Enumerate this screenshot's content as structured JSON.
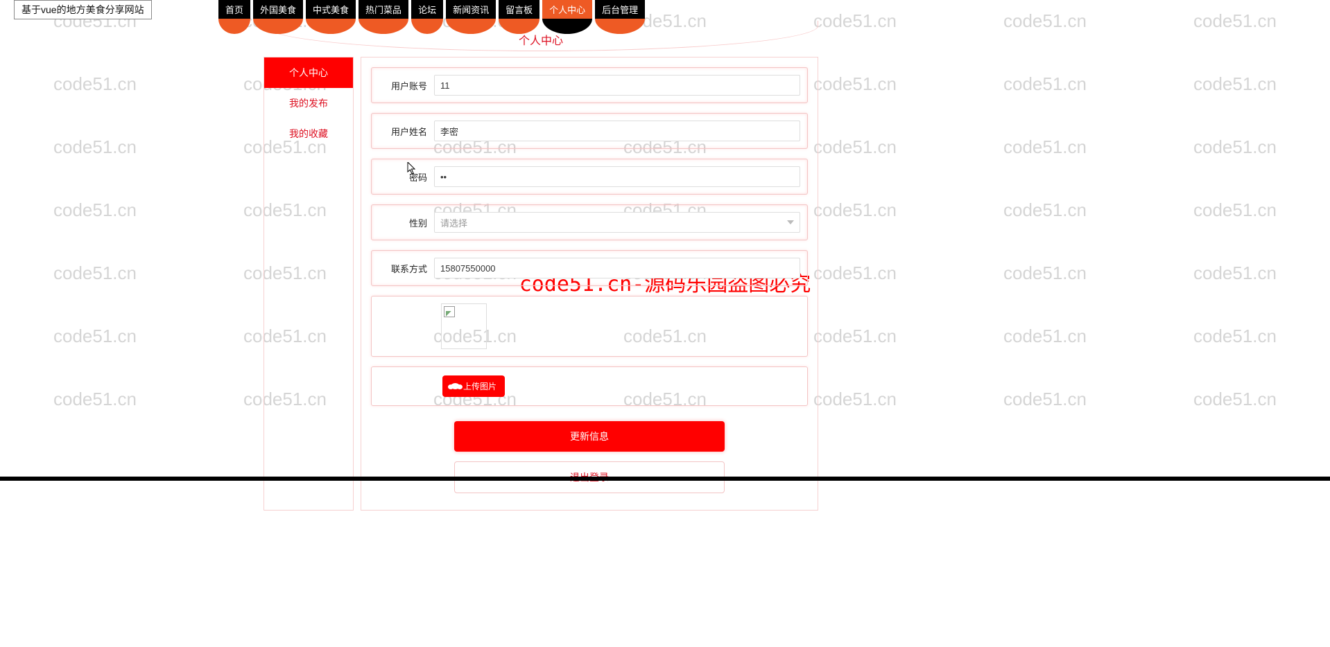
{
  "site_title": "基于vue的地方美食分享网站",
  "watermark_text": "code51.cn",
  "watermark_center": "code51.cn-源码乐园盗图必究",
  "nav": [
    {
      "label": "首页"
    },
    {
      "label": "外国美食"
    },
    {
      "label": "中式美食"
    },
    {
      "label": "热门菜品"
    },
    {
      "label": "论坛"
    },
    {
      "label": "新闻资讯"
    },
    {
      "label": "留言板"
    },
    {
      "label": "个人中心"
    },
    {
      "label": "后台管理"
    }
  ],
  "page_title": "个人中心",
  "sidebar": {
    "items": [
      {
        "label": "个人中心"
      },
      {
        "label": "我的发布"
      },
      {
        "label": "我的收藏"
      }
    ]
  },
  "form": {
    "account": {
      "label": "用户账号",
      "value": "11"
    },
    "name": {
      "label": "用户姓名",
      "value": "李密"
    },
    "password": {
      "label": "密码",
      "value": "••"
    },
    "gender": {
      "label": "性别",
      "placeholder": "请选择"
    },
    "contact": {
      "label": "联系方式",
      "value": "15807550000"
    },
    "upload_btn": "上传图片",
    "update_btn": "更新信息",
    "logout_btn": "退出登录"
  }
}
